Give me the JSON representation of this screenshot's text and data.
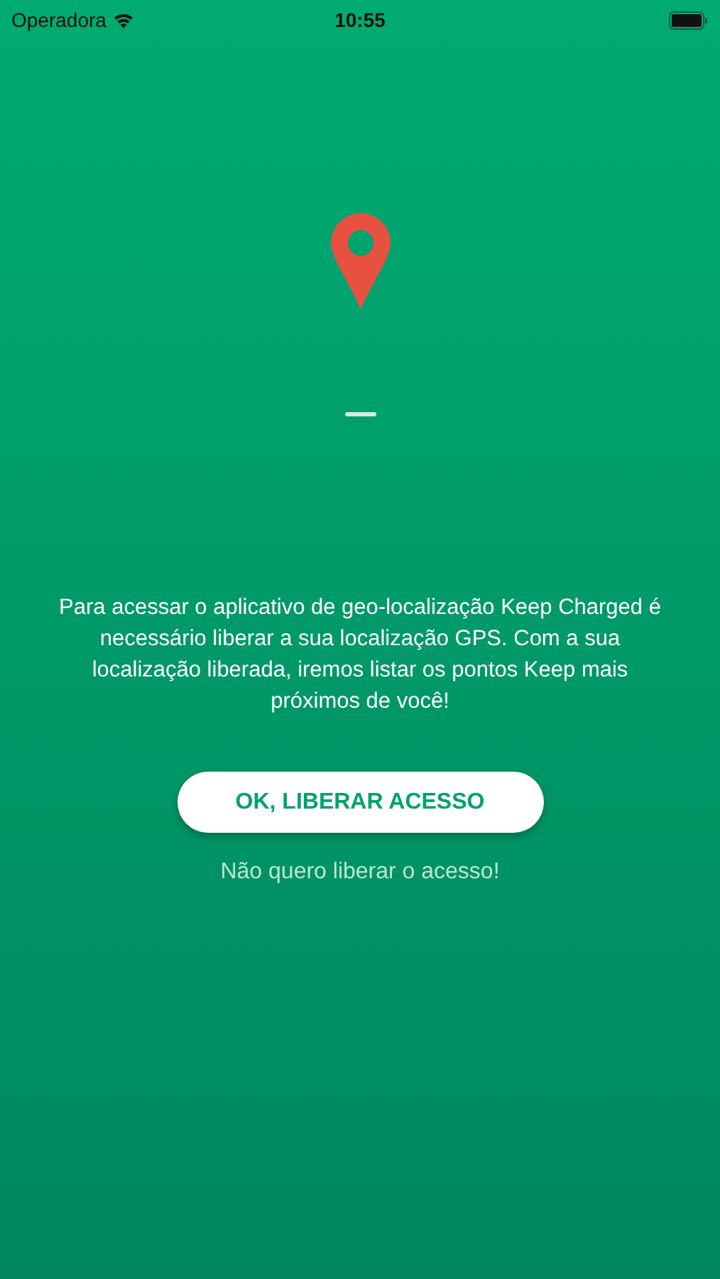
{
  "status_bar": {
    "carrier": "Operadora",
    "time": "10:55"
  },
  "message": "Para acessar o aplicativo de geo-localização Keep Charged é necessário liberar a sua localização GPS. Com a sua localização liberada, iremos listar os pontos Keep mais próximos de você!",
  "primary_button": "OK, LIBERAR ACESSO",
  "secondary_link": "Não quero liberar o acesso!"
}
